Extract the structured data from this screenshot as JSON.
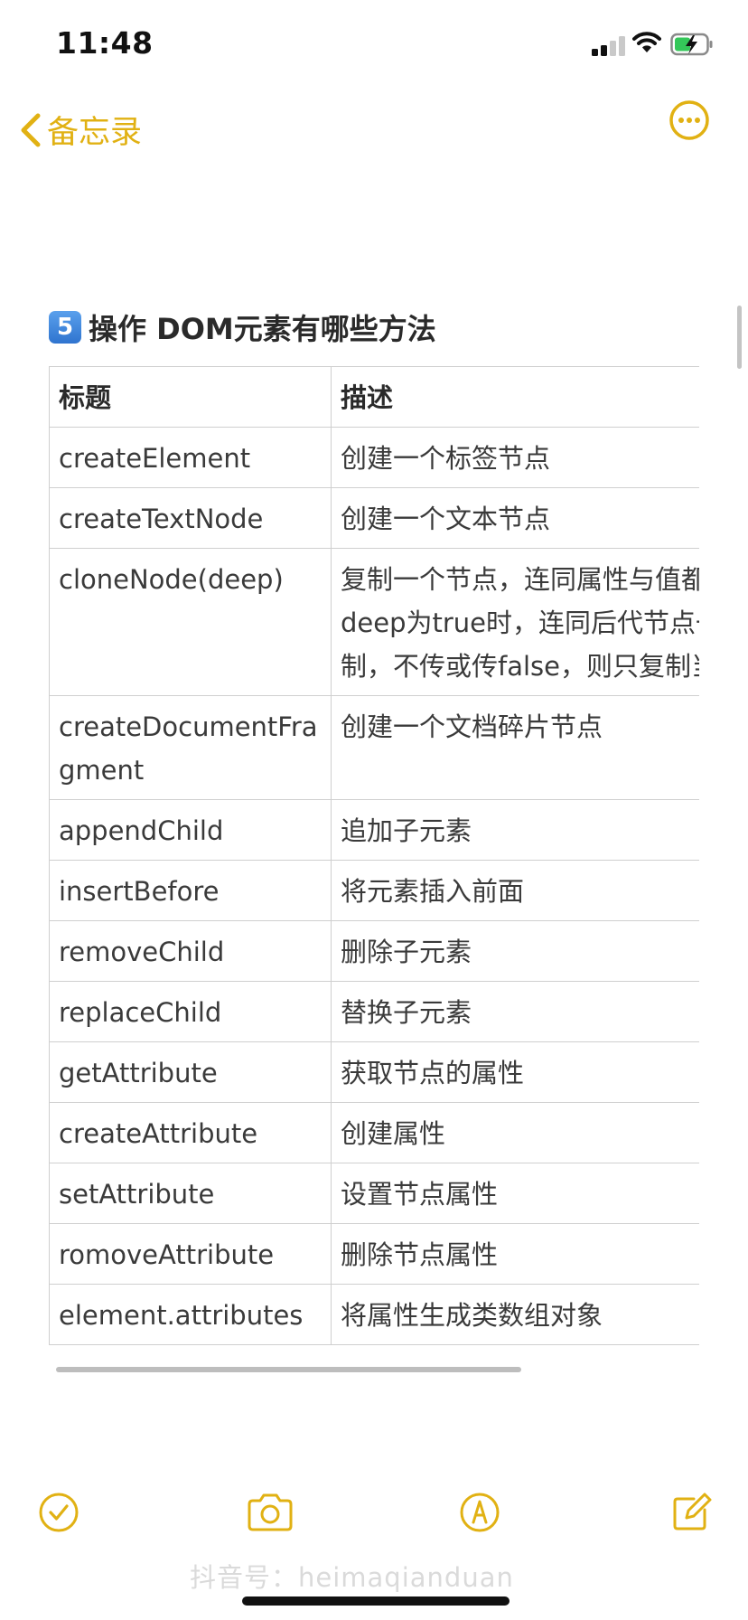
{
  "status": {
    "time": "11:48"
  },
  "nav": {
    "back_label": "备忘录"
  },
  "note": {
    "number": "5",
    "heading": "操作 DOM元素有哪些方法",
    "table": {
      "headers": [
        "标题",
        "描述"
      ],
      "rows": [
        [
          "createElement",
          "创建一个标签节点"
        ],
        [
          "createTextNode",
          "创建一个文本节点"
        ],
        [
          "cloneNode(deep)",
          "复制一个节点，连同属性与值都复制，deep为true时，连同后代节点一起复制，不传或传false，则只复制当前节点"
        ],
        [
          "createDocumentFragment",
          "创建一个文档碎片节点"
        ],
        [
          "appendChild",
          "追加子元素"
        ],
        [
          "insertBefore",
          "将元素插入前面"
        ],
        [
          "removeChild",
          "删除子元素"
        ],
        [
          "replaceChild",
          "替换子元素"
        ],
        [
          "getAttribute",
          "获取节点的属性"
        ],
        [
          "createAttribute",
          "创建属性"
        ],
        [
          "setAttribute",
          "设置节点属性"
        ],
        [
          "romoveAttribute",
          "删除节点属性"
        ],
        [
          "element.attributes",
          "将属性生成类数组对象"
        ]
      ]
    }
  },
  "watermark": "抖音号：heimaqianduan",
  "colors": {
    "accent": "#e1b113"
  },
  "icons": {
    "back": "chevron-left-icon",
    "more": "ellipsis-circle-icon",
    "checklist": "checkmark-circle-icon",
    "camera": "camera-icon",
    "markup": "pen-circle-icon",
    "compose": "compose-icon"
  }
}
